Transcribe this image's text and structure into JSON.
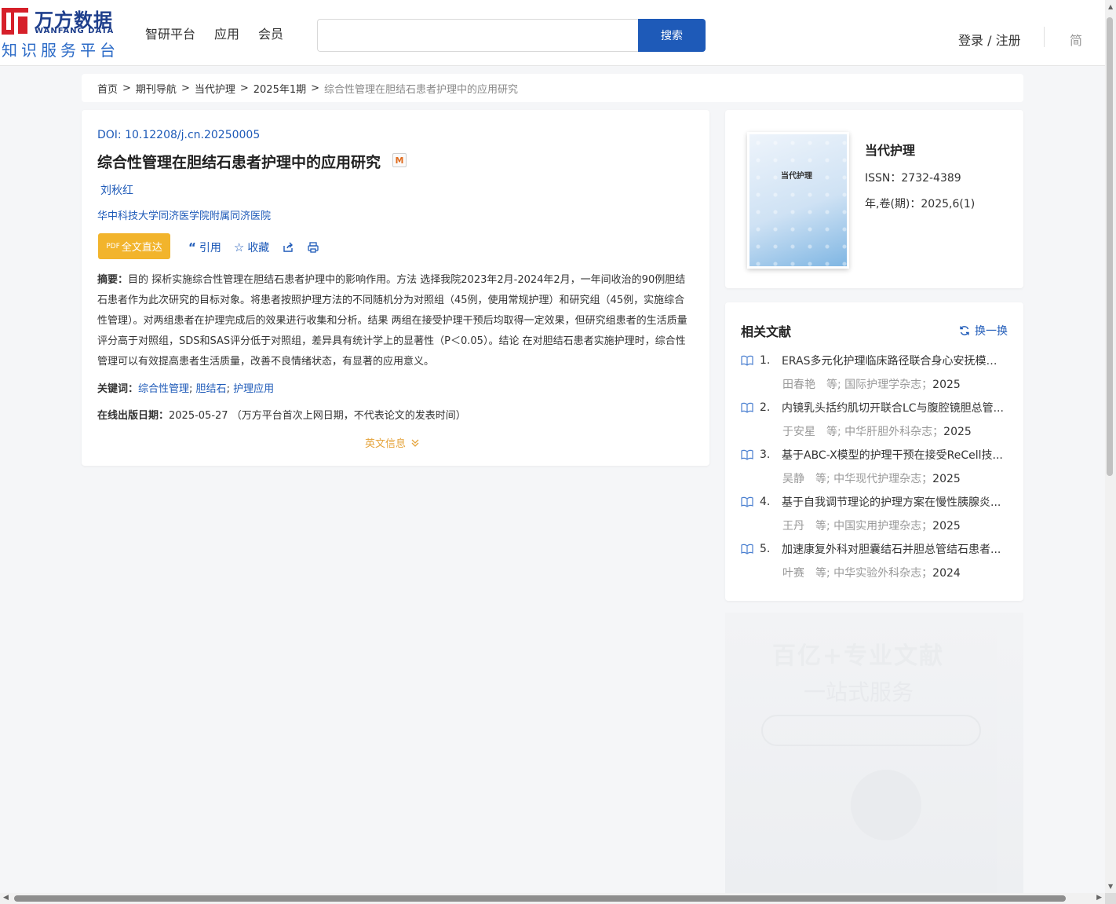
{
  "header": {
    "logo_cn": "万方数据",
    "logo_en": "WANFANG DATA",
    "logo_sub": "知识服务平台",
    "nav": [
      "智研平台",
      "应用",
      "会员"
    ],
    "search_placeholder": "",
    "search_button": "搜索",
    "login": "登录 / 注册",
    "lang": "简"
  },
  "breadcrumb": {
    "items": [
      "首页",
      "期刊导航",
      "当代护理",
      "2025年1期"
    ],
    "current": "综合性管理在胆结石患者护理中的应用研究"
  },
  "article": {
    "doi": "DOI: 10.12208/j.cn.20250005",
    "title": "综合性管理在胆结石患者护理中的应用研究",
    "badge": "M",
    "author": "刘秋红",
    "affiliation": "华中科技大学同济医学院附属同济医院",
    "fulltext_button": "全文直达",
    "fulltext_pdf": "PDF",
    "cite": "引用",
    "favorite": "收藏",
    "abstract_label": "摘要：",
    "abstract": "目的 探析实施综合性管理在胆结石患者护理中的影响作用。方法 选择我院2023年2月-2024年2月，一年间收治的90例胆结石患者作为此次研究的目标对象。将患者按照护理方法的不同随机分为对照组（45例，使用常规护理）和研究组（45例，实施综合性管理）。对两组患者在护理完成后的效果进行收集和分析。结果 两组在接受护理干预后均取得一定效果，但研究组患者的生活质量评分高于对照组，SDS和SAS评分低于对照组，差异具有统计学上的显著性（P＜0.05）。结论 在对胆结石患者实施护理时，综合性管理可以有效提高患者生活质量，改善不良情绪状态，有显著的应用意义。",
    "keywords_label": "关键词：",
    "keywords": [
      "综合性管理",
      "胆结石",
      "护理应用"
    ],
    "pubdate_label": "在线出版日期：",
    "pubdate": "2025-05-27 （万方平台首次上网日期，不代表论文的发表时间）",
    "english_toggle": "英文信息"
  },
  "journal": {
    "cover_title": "当代护理",
    "name": "当代护理",
    "issn": "ISSN：2732-4389",
    "volume": "年,卷(期)：2025,6(1)"
  },
  "related": {
    "title": "相关文献",
    "switch": "换一换",
    "items": [
      {
        "num": "1.",
        "title": "ERAS多元化护理临床路径联合身心安抚模式...",
        "authors": "田春艳　等;",
        "journal": "国际护理学杂志；",
        "year": "2025"
      },
      {
        "num": "2.",
        "title": "内镜乳头括约肌切开联合LC与腹腔镜胆总管...",
        "authors": "于安星　等;",
        "journal": "中华肝胆外科杂志；",
        "year": "2025"
      },
      {
        "num": "3.",
        "title": "基于ABC-X模型的护理干预在接受ReCell技...",
        "authors": "吴静　等;",
        "journal": "中华现代护理杂志；",
        "year": "2025"
      },
      {
        "num": "4.",
        "title": "基于自我调节理论的护理方案在慢性胰腺炎...",
        "authors": "王丹　等;",
        "journal": "中国实用护理杂志；",
        "year": "2025"
      },
      {
        "num": "5.",
        "title": "加速康复外科对胆囊结石并胆总管结石患者...",
        "authors": "叶赛　等;",
        "journal": "中华实验外科杂志；",
        "year": "2024"
      }
    ]
  },
  "ad": {
    "line1": "百亿+专业文献",
    "line2": "一站式服务"
  },
  "colors": {
    "brand_blue": "#1e5ab8",
    "logo_red": "#d6202a",
    "fulltext_orange": "#f2b42c",
    "toggle_orange": "#e5a33a"
  }
}
